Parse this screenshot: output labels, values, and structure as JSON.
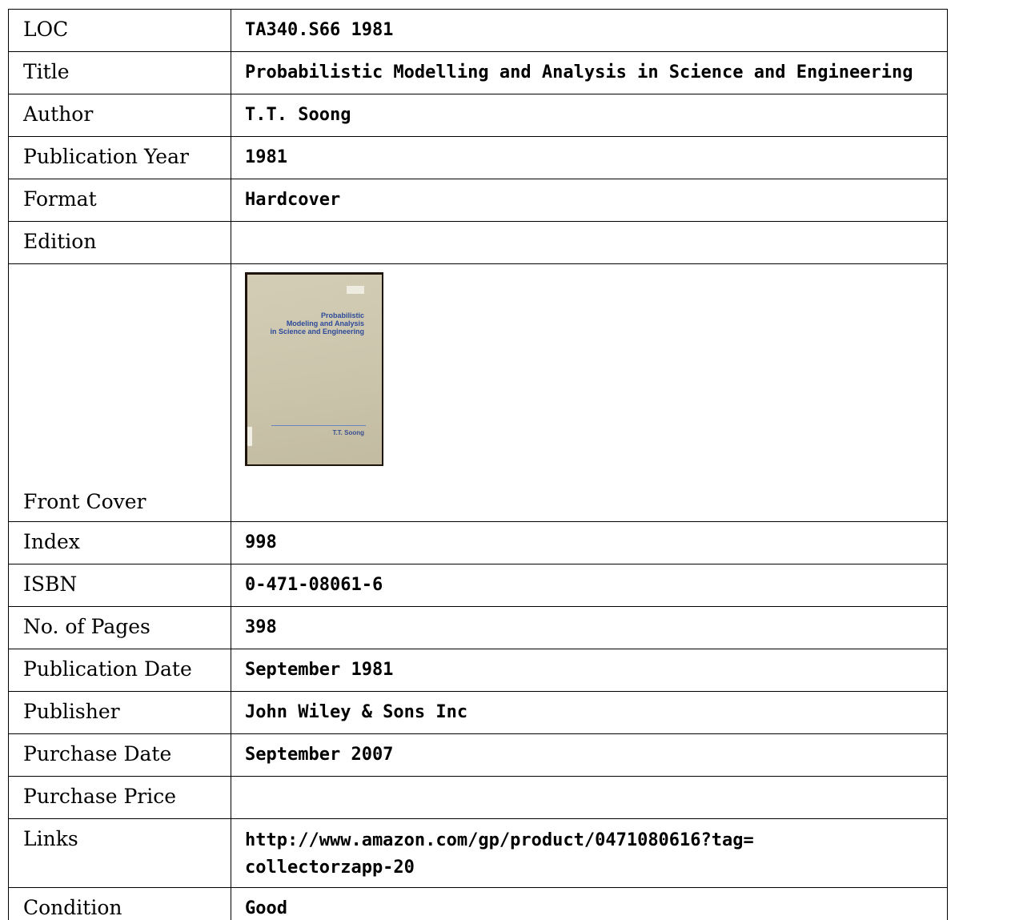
{
  "rows": {
    "loc": {
      "label": "LOC",
      "value": "TA340.S66 1981"
    },
    "title": {
      "label": "Title",
      "value": "Probabilistic Modelling and Analysis in Science and Engineering"
    },
    "author": {
      "label": "Author",
      "value": "T.T. Soong"
    },
    "pub_year": {
      "label": "Publication Year",
      "value": "1981"
    },
    "format": {
      "label": "Format",
      "value": "Hardcover"
    },
    "edition": {
      "label": "Edition",
      "value": ""
    },
    "front_cover": {
      "label": "Front Cover"
    },
    "index": {
      "label": "Index",
      "value": "998"
    },
    "isbn": {
      "label": "ISBN",
      "value": "0-471-08061-6"
    },
    "pages": {
      "label": "No. of Pages",
      "value": "398"
    },
    "pub_date": {
      "label": "Publication Date",
      "value": "September 1981"
    },
    "publisher": {
      "label": "Publisher",
      "value": "John Wiley & Sons Inc"
    },
    "purchase_date": {
      "label": "Purchase Date",
      "value": "September 2007"
    },
    "purchase_price": {
      "label": "Purchase Price",
      "value": ""
    },
    "links": {
      "label": "Links",
      "line1": "http://www.amazon.com/gp/product/0471080616?tag=",
      "line2": "collectorzapp-20"
    },
    "condition": {
      "label": "Condition",
      "value": "Good"
    }
  },
  "cover": {
    "title_line1": "Probabilistic",
    "title_line2": "Modeling and Analysis",
    "title_line3": "in Science and Engineering",
    "author": "T.T. Soong"
  }
}
